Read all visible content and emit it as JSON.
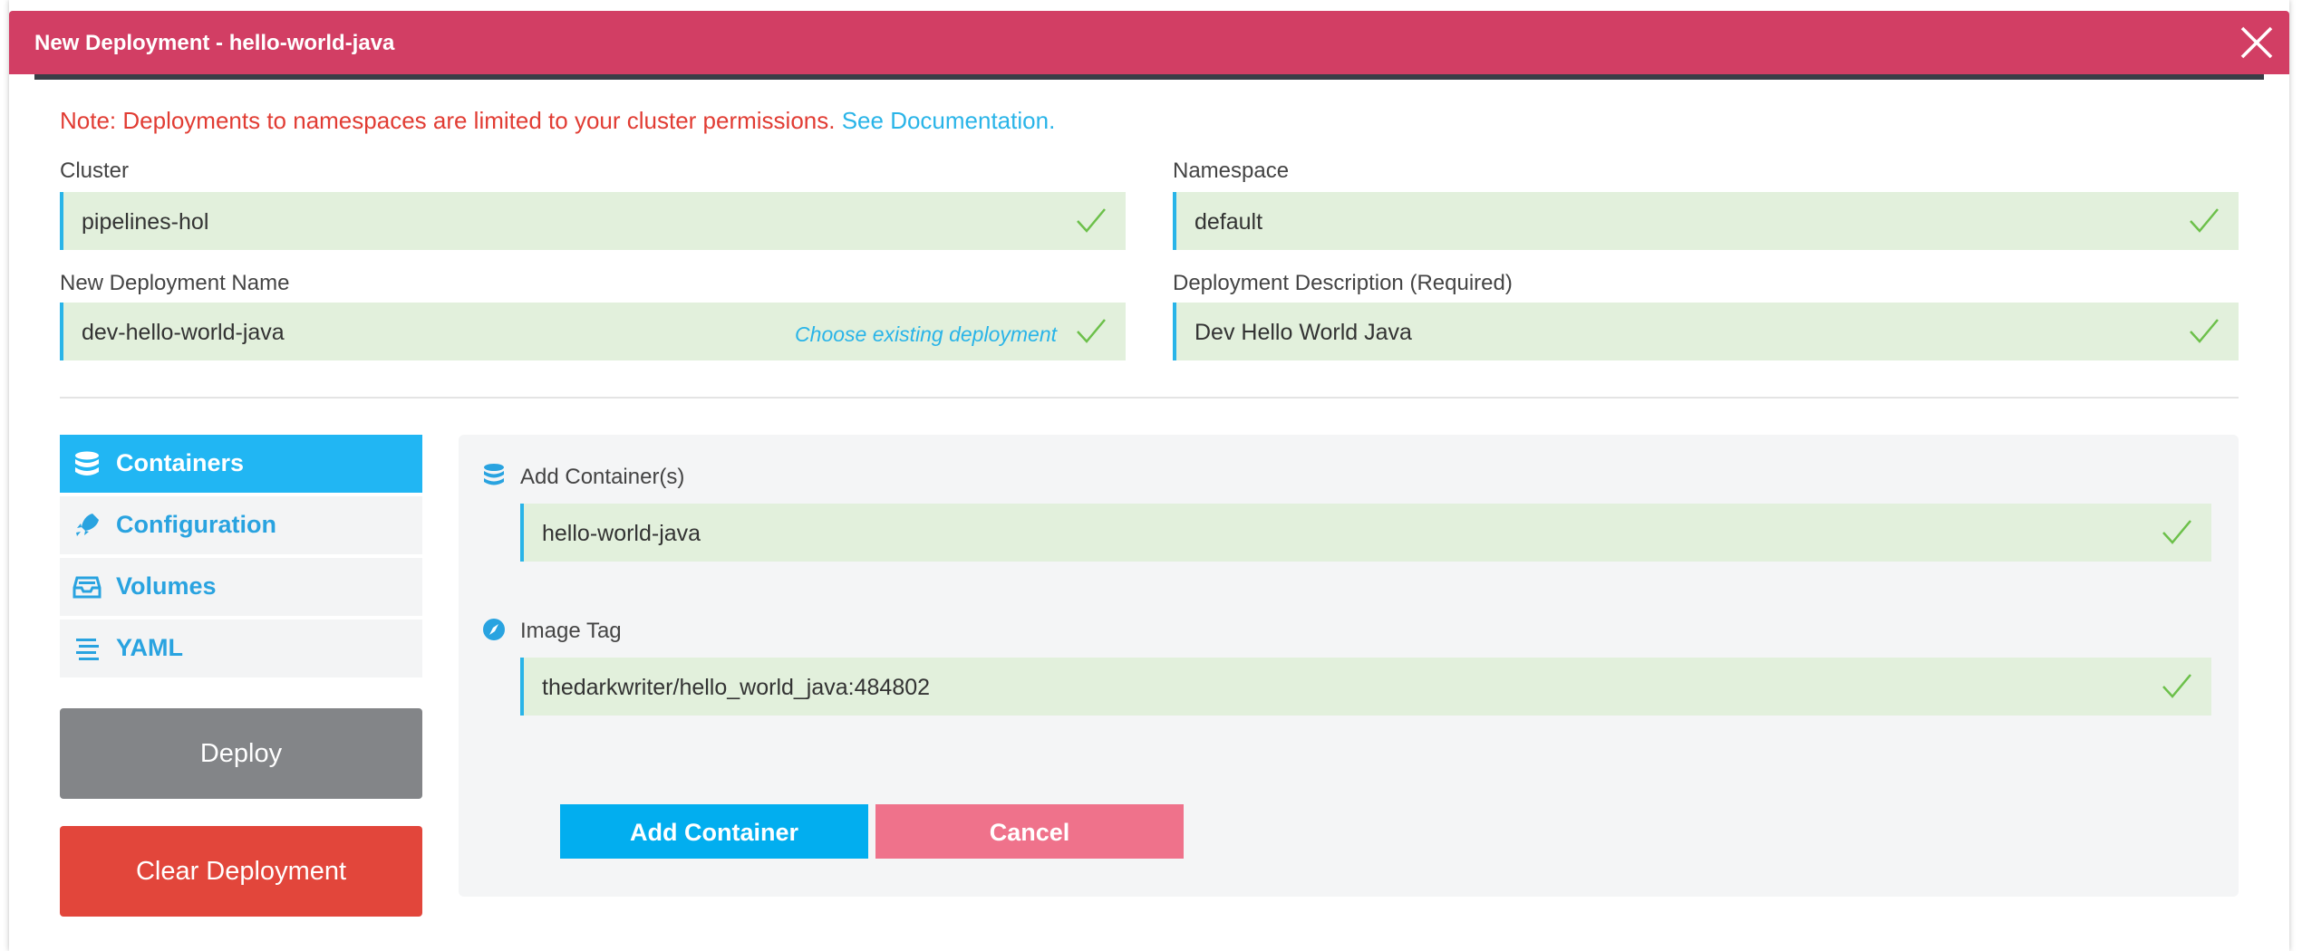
{
  "modal": {
    "title": "New Deployment - hello-world-java",
    "close_icon": "close-icon"
  },
  "note": {
    "text": "Note: Deployments to namespaces are limited to your cluster permissions. ",
    "link": "See Documentation."
  },
  "form": {
    "cluster": {
      "label": "Cluster",
      "value": "pipelines-hol"
    },
    "namespace": {
      "label": "Namespace",
      "value": "default"
    },
    "deployment_name": {
      "label": "New Deployment Name",
      "value": "dev-hello-world-java",
      "choose_link": "Choose existing deployment"
    },
    "deployment_description": {
      "label": "Deployment Description (Required)",
      "value": "Dev Hello World Java"
    }
  },
  "sidebar": {
    "items": [
      {
        "label": "Containers",
        "icon": "database-icon",
        "active": true
      },
      {
        "label": "Configuration",
        "icon": "rocket-icon",
        "active": false
      },
      {
        "label": "Volumes",
        "icon": "inbox-icon",
        "active": false
      },
      {
        "label": "YAML",
        "icon": "lines-icon",
        "active": false
      }
    ],
    "deploy_label": "Deploy",
    "clear_label": "Clear Deployment"
  },
  "panel": {
    "add_containers_label": "Add Container(s)",
    "container_value": "hello-world-java",
    "image_tag_label": "Image Tag",
    "image_tag_value": "thedarkwriter/hello_world_java:484802",
    "add_button": "Add Container",
    "cancel_button": "Cancel"
  },
  "colors": {
    "titlebar": "#d23e64",
    "accent": "#21b6f3",
    "field_bg": "#e2f0dc",
    "check": "#6cc04a",
    "note_red": "#e13c33",
    "deploy_gray": "#838588",
    "clear_red": "#e2463b",
    "add_blue": "#02aeef",
    "cancel_pink": "#ef728b"
  }
}
